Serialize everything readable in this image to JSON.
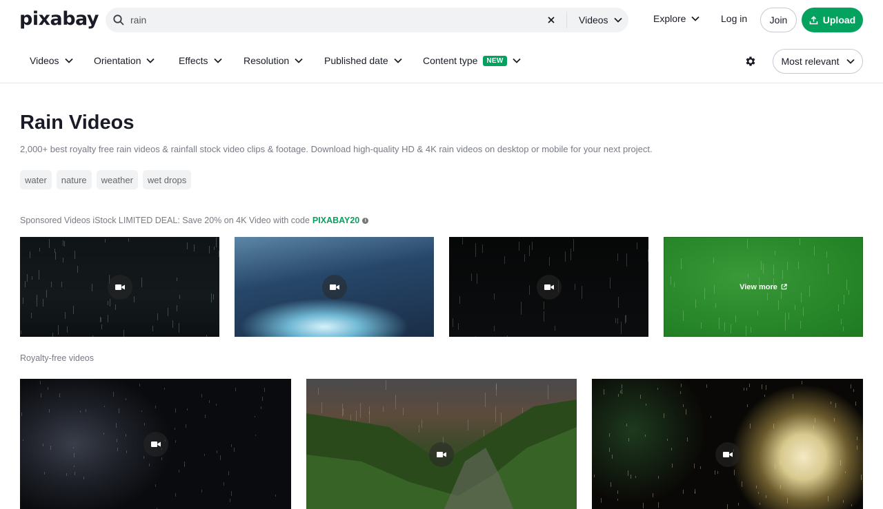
{
  "header": {
    "logo": "pixabay",
    "search": {
      "value": "rain",
      "placeholder": ""
    },
    "search_type": "Videos",
    "explore": "Explore",
    "login": "Log in",
    "join": "Join",
    "upload": "Upload"
  },
  "filters": {
    "items": [
      {
        "label": "Videos"
      },
      {
        "label": "Orientation"
      },
      {
        "label": "Effects"
      },
      {
        "label": "Resolution"
      },
      {
        "label": "Published date"
      },
      {
        "label": "Content type",
        "badge": "NEW"
      }
    ],
    "sort": "Most relevant"
  },
  "page": {
    "title": "Rain Videos",
    "description": "2,000+ best royalty free rain videos & rainfall stock video clips & footage. Download high-quality HD & 4K rain videos on desktop or mobile for your next project.",
    "tags": [
      "water",
      "nature",
      "weather",
      "wet drops"
    ]
  },
  "sponsored": {
    "text": "Sponsored Videos iStock LIMITED DEAL: Save 20% on 4K Video with code",
    "code": "PIXABAY20",
    "view_more": "View more"
  },
  "royalty_free": {
    "label": "Royalty-free videos"
  },
  "colors": {
    "accent": "#04a25f",
    "text": "#191b26",
    "muted": "#787a85"
  }
}
